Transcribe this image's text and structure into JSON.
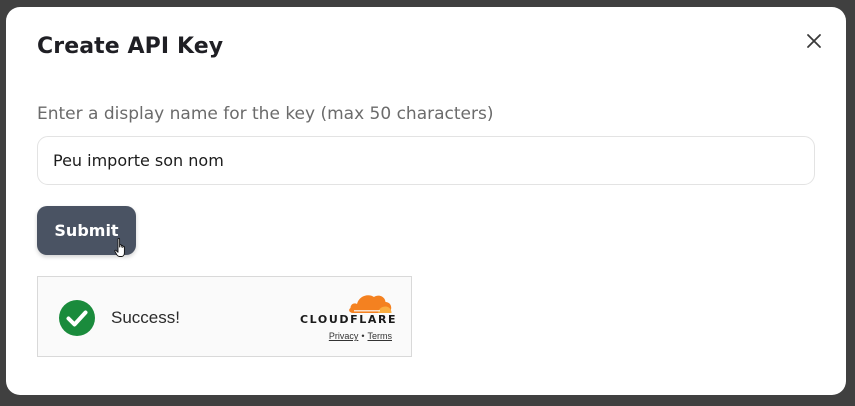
{
  "modal": {
    "title": "Create API Key",
    "close_icon": "close-icon"
  },
  "form": {
    "label": "Enter a display name for the key (max 50 characters)",
    "name_value": "Peu importe son nom",
    "submit_label": "Submit"
  },
  "captcha": {
    "status_text": "Success!",
    "status_icon": "checkmark-circle-icon",
    "brand": "CLOUDFLARE",
    "privacy_link": "Privacy",
    "separator": "•",
    "terms_link": "Terms"
  },
  "colors": {
    "submit_button": "#4a5363",
    "success_green": "#1a8b3c",
    "cloudflare_orange": "#f48120"
  }
}
